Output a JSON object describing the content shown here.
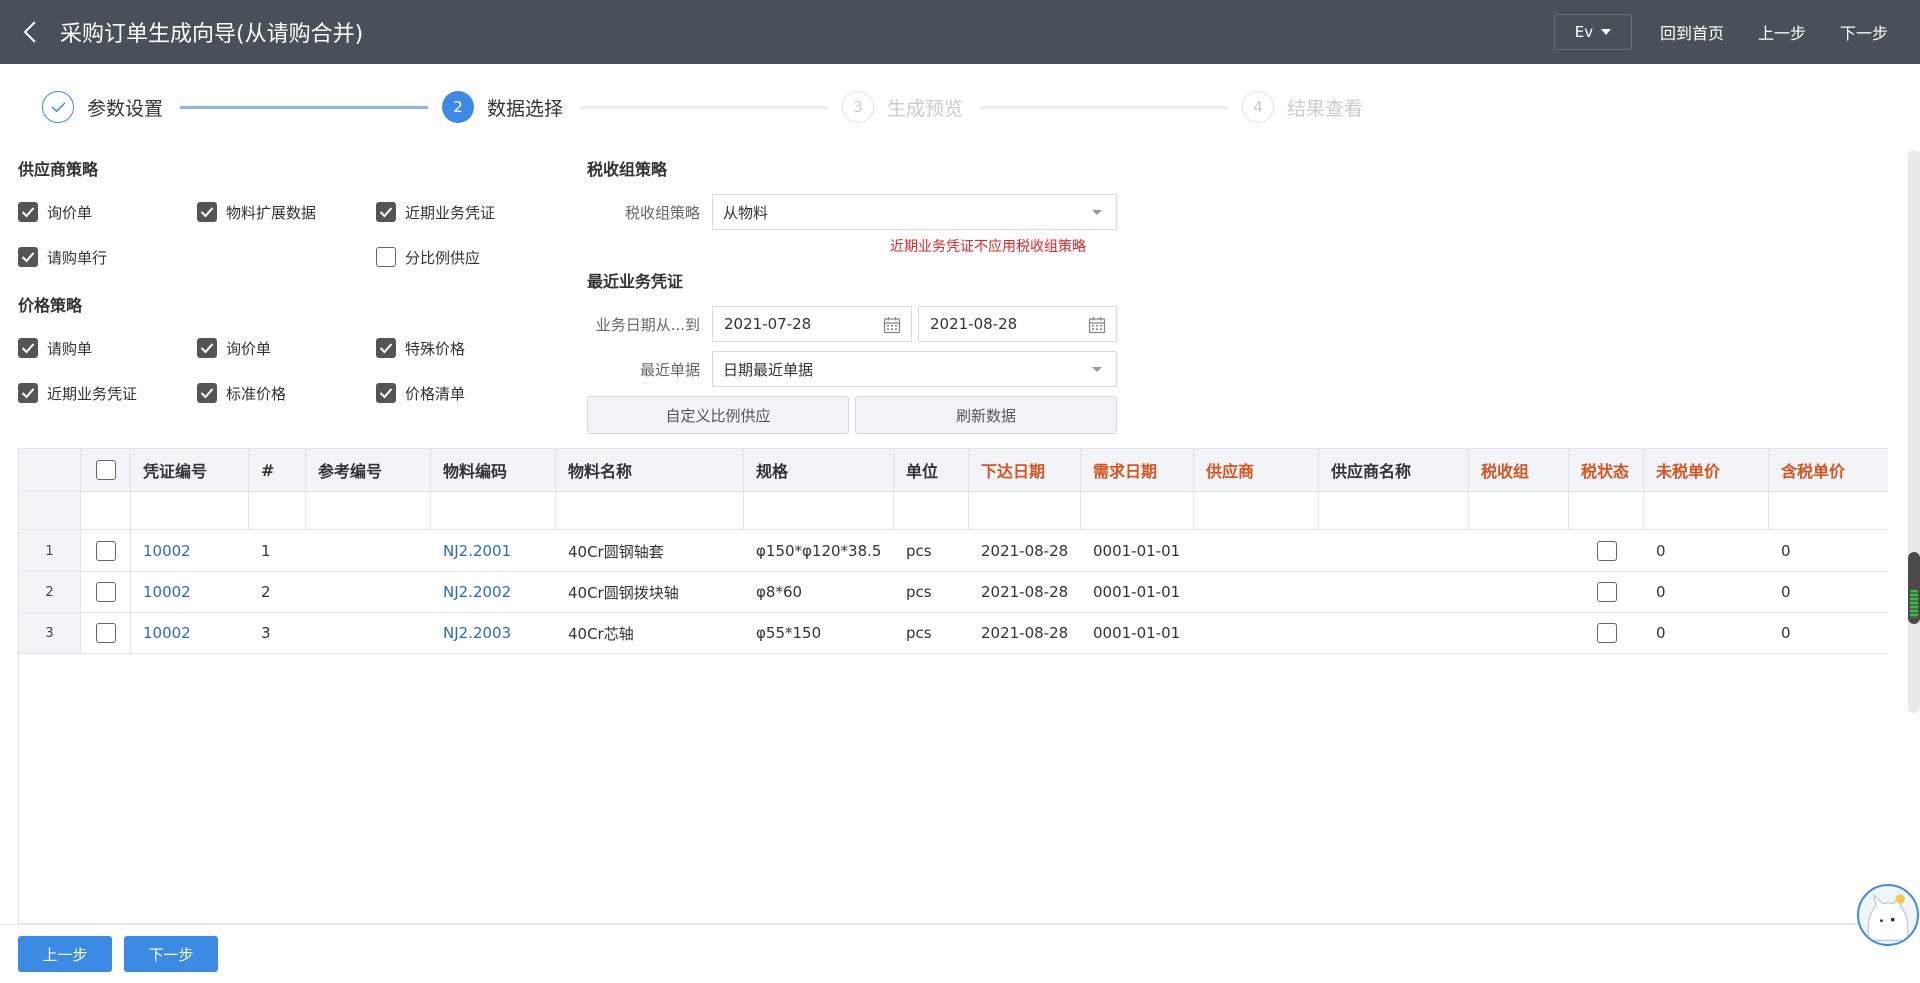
{
  "header": {
    "title": "采购订单生成向导(从请购合并)",
    "ev_label": "Ev",
    "home_label": "回到首页",
    "prev_label": "上一步",
    "next_label": "下一步"
  },
  "steps": [
    {
      "num": "1",
      "label": "参数设置",
      "state": "done"
    },
    {
      "num": "2",
      "label": "数据选择",
      "state": "active"
    },
    {
      "num": "3",
      "label": "生成预览",
      "state": "pending"
    },
    {
      "num": "4",
      "label": "结果查看",
      "state": "pending"
    }
  ],
  "supplier_strategy": {
    "title": "供应商策略",
    "options": [
      {
        "label": "询价单",
        "checked": true
      },
      {
        "label": "物料扩展数据",
        "checked": true
      },
      {
        "label": "近期业务凭证",
        "checked": true
      },
      {
        "label": "请购单行",
        "checked": true
      },
      {
        "label": "分比例供应",
        "checked": false
      }
    ]
  },
  "price_strategy": {
    "title": "价格策略",
    "options": [
      {
        "label": "请购单",
        "checked": true
      },
      {
        "label": "询价单",
        "checked": true
      },
      {
        "label": "特殊价格",
        "checked": true
      },
      {
        "label": "近期业务凭证",
        "checked": true
      },
      {
        "label": "标准价格",
        "checked": true
      },
      {
        "label": "价格清单",
        "checked": true
      }
    ]
  },
  "tax_strategy": {
    "title": "税收组策略",
    "label": "税收组策略",
    "value": "从物料",
    "warning": "近期业务凭证不应用税收组策略"
  },
  "recent_docs": {
    "title": "最近业务凭证",
    "date_label": "业务日期从...到",
    "date_from": "2021-07-28",
    "date_to": "2021-08-28",
    "latest_label": "最近单据",
    "latest_value": "日期最近单据",
    "custom_btn": "自定义比例供应",
    "refresh_btn": "刷新数据"
  },
  "table": {
    "columns": [
      "凭证编号",
      "#",
      "参考编号",
      "物料编码",
      "物料名称",
      "规格",
      "单位",
      "下达日期",
      "需求日期",
      "供应商",
      "供应商名称",
      "税收组",
      "税状态",
      "未税单价",
      "含税单价"
    ],
    "rows": [
      {
        "rownum": "1",
        "doc_no": "10002",
        "line": "1",
        "ref": "",
        "material_code": "NJ2.2001",
        "material_name": "40Cr圆钢轴套",
        "spec": "φ150*φ120*38.5",
        "unit": "pcs",
        "issue_date": "2021-08-28",
        "demand_date": "0001-01-01",
        "supplier": "",
        "supplier_name": "",
        "tax_group": "",
        "net_price": "0",
        "gross_price": "0"
      },
      {
        "rownum": "2",
        "doc_no": "10002",
        "line": "2",
        "ref": "",
        "material_code": "NJ2.2002",
        "material_name": "40Cr圆钢拨块轴",
        "spec": "φ8*60",
        "unit": "pcs",
        "issue_date": "2021-08-28",
        "demand_date": "0001-01-01",
        "supplier": "",
        "supplier_name": "",
        "tax_group": "",
        "net_price": "0",
        "gross_price": "0"
      },
      {
        "rownum": "3",
        "doc_no": "10002",
        "line": "3",
        "ref": "",
        "material_code": "NJ2.2003",
        "material_name": "40Cr芯轴",
        "spec": "φ55*150",
        "unit": "pcs",
        "issue_date": "2021-08-28",
        "demand_date": "0001-01-01",
        "supplier": "",
        "supplier_name": "",
        "tax_group": "",
        "net_price": "0",
        "gross_price": "0"
      }
    ]
  },
  "footer": {
    "prev_label": "上一步",
    "next_label": "下一步"
  },
  "colors": {
    "header_bg": "#4a5059",
    "accent": "#3b8be5",
    "required_col": "#d9531e",
    "warning": "#e0262b",
    "link": "#2a6cb8"
  }
}
